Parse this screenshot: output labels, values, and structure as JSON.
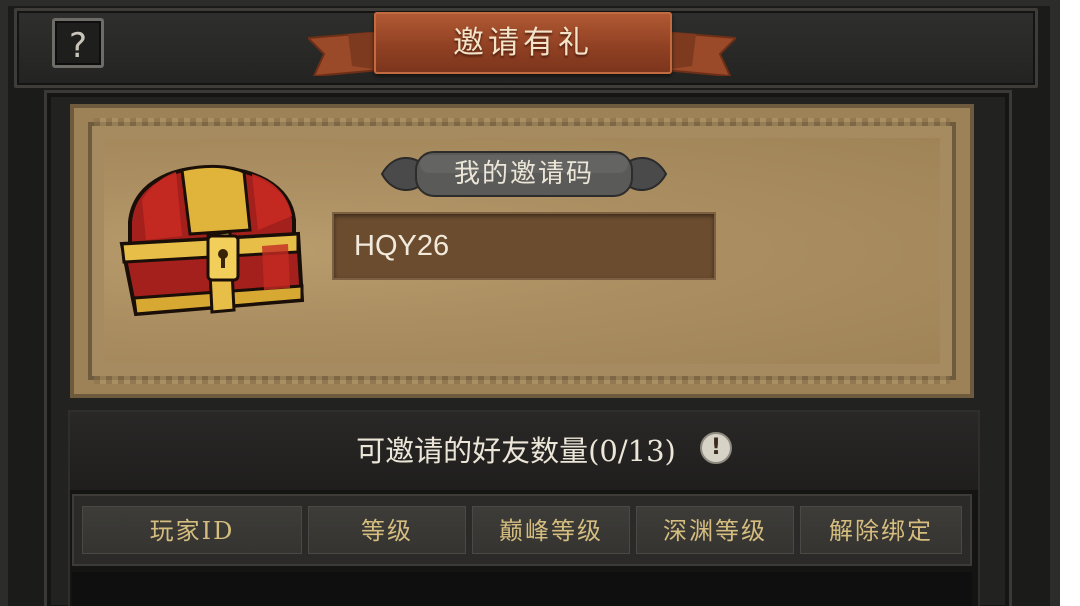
{
  "header": {
    "title": "邀请有礼",
    "help_label": "?",
    "help_icon": "question-mark-icon"
  },
  "invite": {
    "code_label": "我的邀请码",
    "code_value": "HQY26",
    "chest_icon": "treasure-chest-icon"
  },
  "friends": {
    "title": "可邀请的好友数量(0/13)",
    "info_icon_glyph": "!",
    "info_icon": "info-icon"
  },
  "table": {
    "columns": [
      "玩家ID",
      "等级",
      "巅峰等级",
      "深渊等级",
      "解除绑定"
    ]
  },
  "colors": {
    "banner": "#9a4726",
    "parchment": "#ab8f62",
    "code_field": "#6b4c2f",
    "column_text": "#d4bd7e"
  }
}
